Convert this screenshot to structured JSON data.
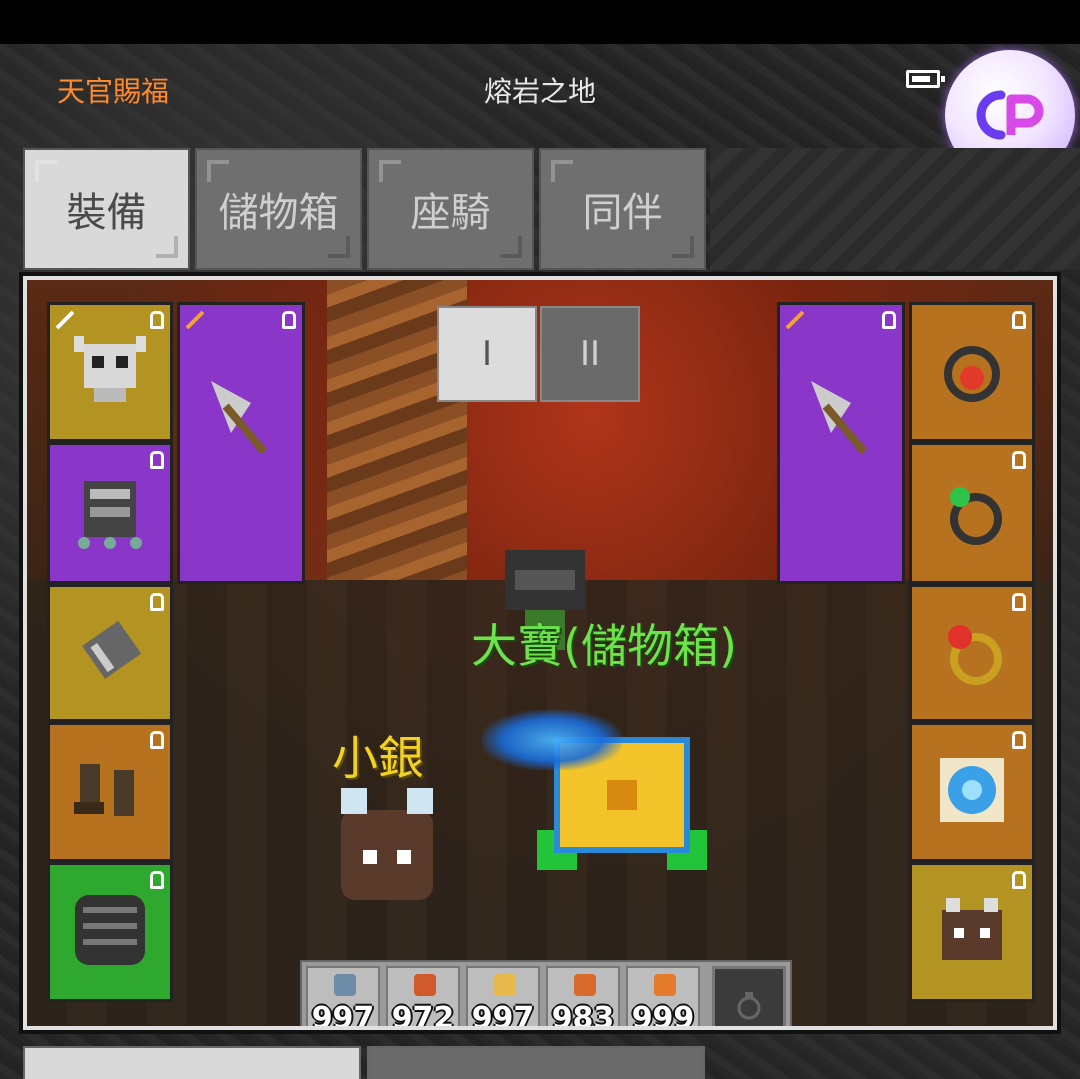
{
  "header": {
    "left_label": "天官賜福",
    "title": "熔岩之地"
  },
  "tabs": [
    {
      "label": "裝備",
      "active": true
    },
    {
      "label": "儲物箱",
      "active": false
    },
    {
      "label": "座騎",
      "active": false
    },
    {
      "label": "同伴",
      "active": false
    }
  ],
  "page_toggle": {
    "page_1": "I",
    "page_2": "II",
    "active": "I"
  },
  "characters": {
    "pet_name": "大寶(儲物箱)",
    "companion_name": "小銀"
  },
  "potions": [
    {
      "count": "997",
      "color": "#6c8ca8"
    },
    {
      "count": "972",
      "color": "#d15a2a"
    },
    {
      "count": "997",
      "color": "#e7b84a"
    },
    {
      "count": "983",
      "color": "#d86b2a"
    },
    {
      "count": "999",
      "color": "#e27a2a"
    }
  ],
  "colors": {
    "slot_gold": "#b39322",
    "slot_orange": "#b7721f",
    "slot_purple": "#8a36c9",
    "slot_green": "#2ea82e",
    "pet_name": "#6ee24a",
    "companion_name": "#f2d21f",
    "header_left": "#ff8a2a"
  },
  "icons": {
    "battery": "battery-icon",
    "app_badge": "cp-logo-icon"
  }
}
